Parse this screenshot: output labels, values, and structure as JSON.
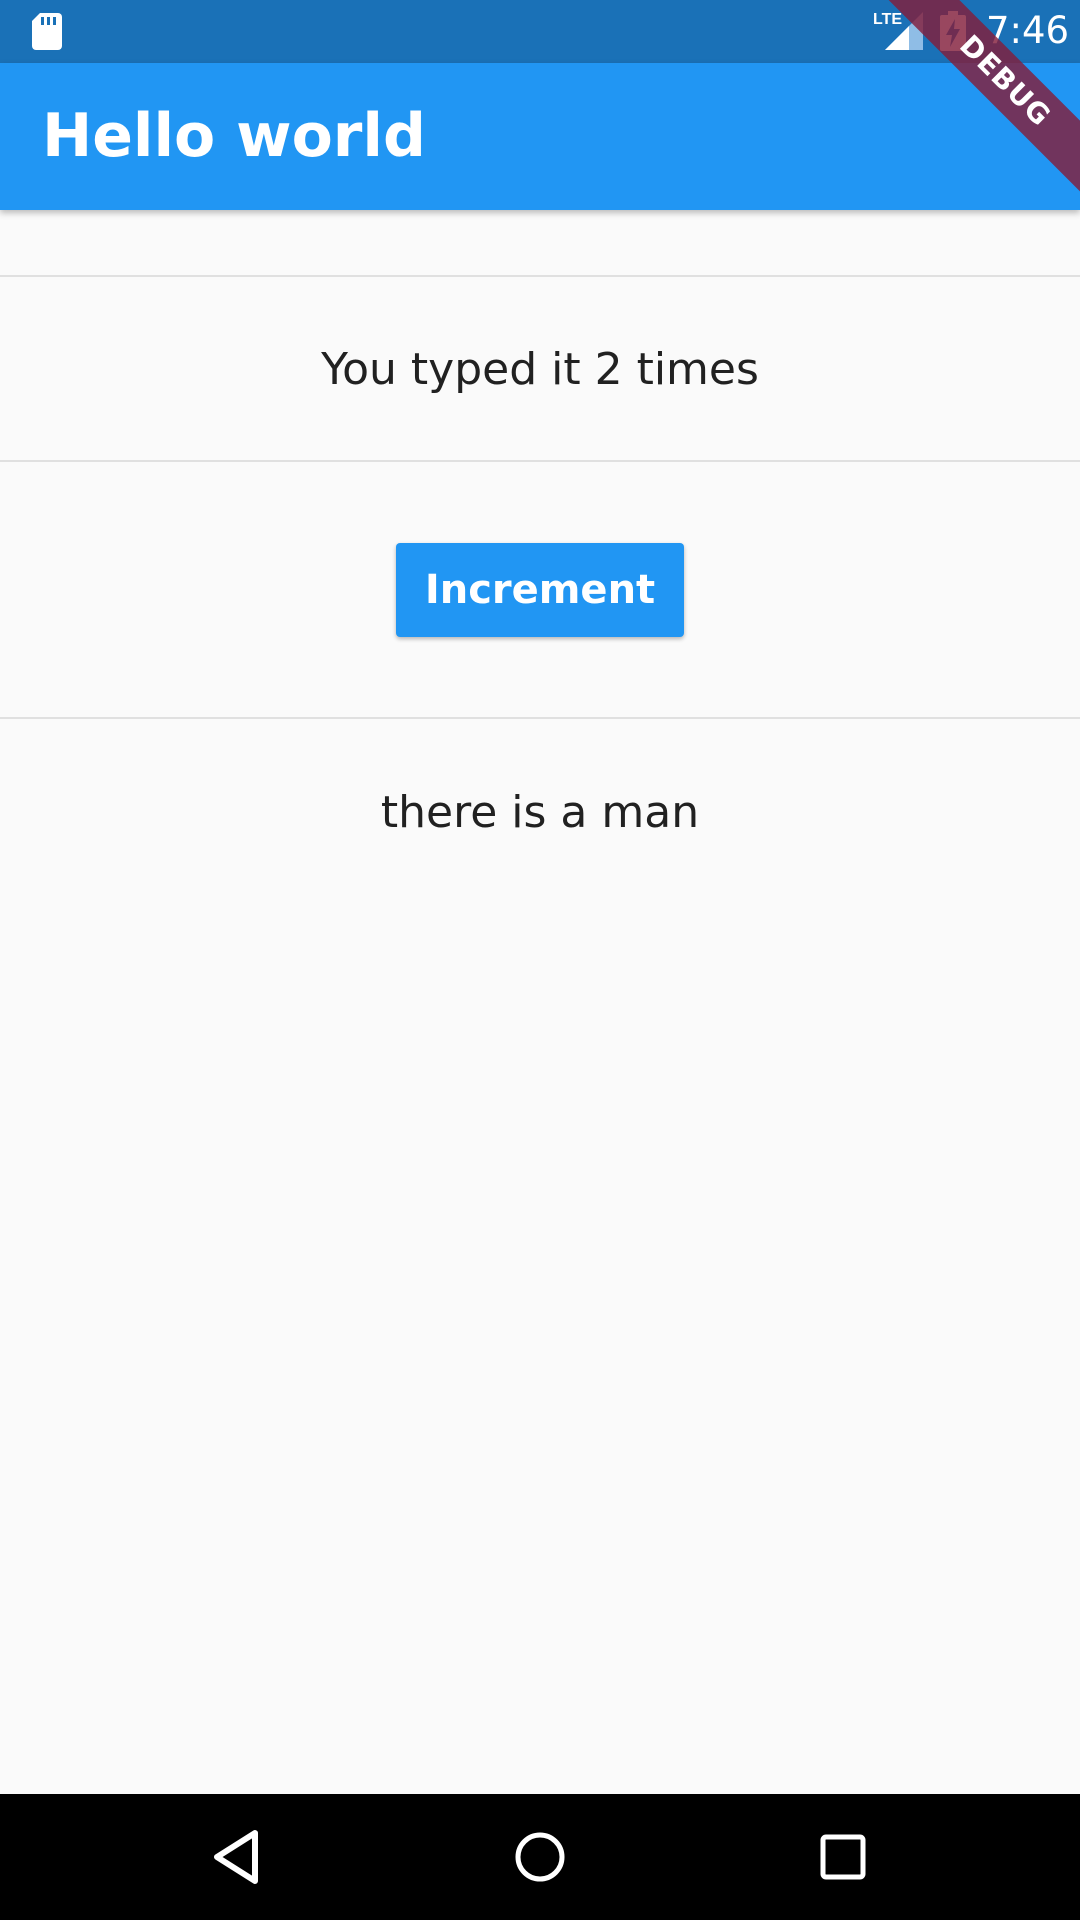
{
  "status_bar": {
    "time": "7:46",
    "network": "LTE",
    "icons": [
      "sd-card-icon",
      "lte-signal-icon",
      "battery-charging-icon"
    ]
  },
  "app_bar": {
    "title": "Hello world",
    "debug_banner": "DEBUG"
  },
  "main": {
    "count_text": "You typed it 2 times",
    "increment_label": "Increment",
    "message": "there is a man"
  },
  "nav_bar": {
    "icons": [
      "back-icon",
      "home-icon",
      "recents-icon"
    ]
  },
  "colors": {
    "status_bar": "#1a71b7",
    "app_bar": "#2196f3",
    "button": "#2196f3",
    "background": "#fafafa",
    "text": "#212121",
    "debug_banner": "#821e3c"
  }
}
